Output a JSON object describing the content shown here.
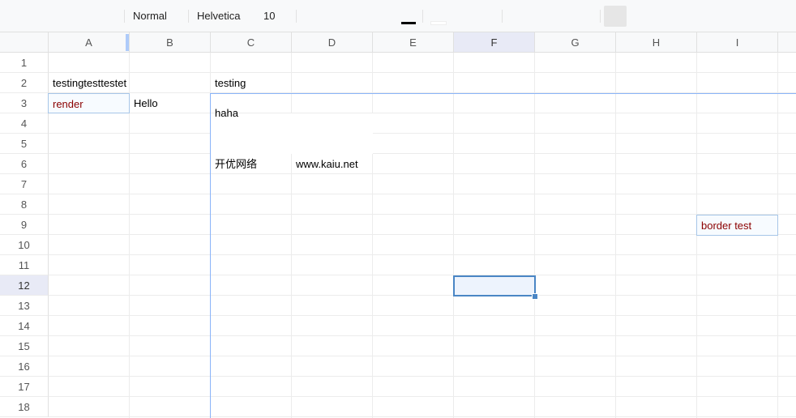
{
  "toolbar": {
    "style": "Normal",
    "font_family": "Helvetica",
    "font_size": "10",
    "text_color": "#000000",
    "fill_color": "#ffffff"
  },
  "columns": [
    "A",
    "B",
    "C",
    "D",
    "E",
    "F",
    "G",
    "H",
    "I"
  ],
  "rows": [
    "1",
    "2",
    "3",
    "4",
    "5",
    "6",
    "7",
    "8",
    "9",
    "10",
    "11",
    "12",
    "13",
    "14",
    "15",
    "16",
    "17",
    "18"
  ],
  "active_column": "F",
  "active_row": "12",
  "selected_cell": "F12",
  "cells": {
    "A2": "testingtesttestet",
    "C2": "testing",
    "A3": "render",
    "B3": "Hello",
    "C3": "haha",
    "C6": "开优网络",
    "D6": "www.kaiu.net",
    "I9": "border test"
  },
  "colors": {
    "accent": "#4a86c5",
    "red_text": "#8b0000",
    "header_bg": "#f8f9fa",
    "active_header_bg": "#e8eaf6"
  }
}
